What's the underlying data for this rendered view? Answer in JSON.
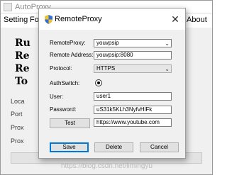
{
  "main_window": {
    "title": "AutoProxy",
    "menu": [
      "Setting",
      "For",
      "About"
    ],
    "big_labels": [
      "Ru",
      "Re",
      "Re",
      "To"
    ],
    "side_labels": [
      "Loca",
      "Port",
      "Prox",
      "Prox"
    ]
  },
  "dialog": {
    "title": "RemoteProxy",
    "close_glyph": "✕",
    "fields": {
      "remote_proxy_label": "RemoteProxy:",
      "remote_proxy_value": "youvpsip",
      "remote_address_label": "Remote Address:",
      "remote_address_value": "youvpsip:8080",
      "protocol_label": "Protocol:",
      "protocol_value": "HTTPS",
      "auth_switch_label": "AuthSwitch:",
      "auth_switch_on": true,
      "user_label": "User:",
      "user_value": "user1",
      "password_label": "Password:",
      "password_value": "uS31k5KLh3NyfvHlFk",
      "test_url_value": "https://www.youtube.com"
    },
    "buttons": {
      "test": "Test",
      "save": "Save",
      "delete": "Delete",
      "cancel": "Cancel"
    }
  },
  "watermark": "https://blog.csdn.net/limingyu"
}
